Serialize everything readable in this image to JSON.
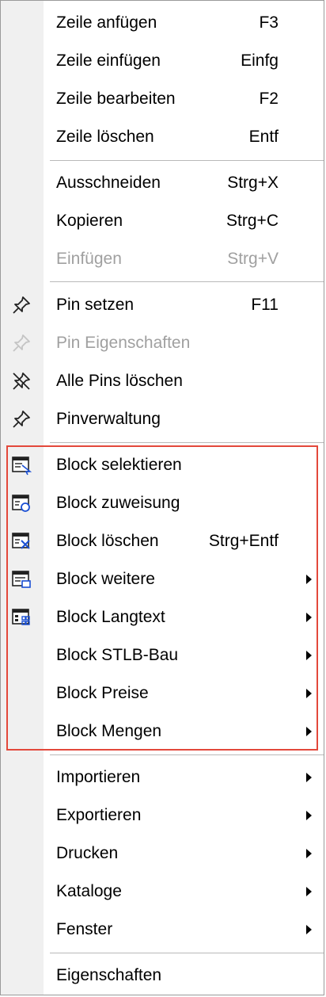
{
  "menu": {
    "items": [
      {
        "label": "Zeile anfügen",
        "shortcut": "F3"
      },
      {
        "label": "Zeile einfügen",
        "shortcut": "Einfg"
      },
      {
        "label": "Zeile bearbeiten",
        "shortcut": "F2"
      },
      {
        "label": "Zeile löschen",
        "shortcut": "Entf"
      },
      {
        "label": "Ausschneiden",
        "shortcut": "Strg+X"
      },
      {
        "label": "Kopieren",
        "shortcut": "Strg+C"
      },
      {
        "label": "Einfügen",
        "shortcut": "Strg+V",
        "disabled": true
      },
      {
        "label": "Pin setzen",
        "shortcut": "F11",
        "icon": "pin-icon"
      },
      {
        "label": "Pin Eigenschaften",
        "disabled": true,
        "icon": "pin-icon"
      },
      {
        "label": "Alle Pins löschen",
        "icon": "pin-remove-icon"
      },
      {
        "label": "Pinverwaltung",
        "icon": "pin-icon"
      },
      {
        "label": "Block selektieren",
        "icon": "block-select-icon"
      },
      {
        "label": "Block zuweisung",
        "icon": "block-assign-icon"
      },
      {
        "label": "Block löschen",
        "shortcut": "Strg+Entf",
        "icon": "block-delete-icon"
      },
      {
        "label": "Block weitere",
        "submenu": true,
        "icon": "block-more-icon"
      },
      {
        "label": "Block Langtext",
        "submenu": true,
        "icon": "block-longtext-icon"
      },
      {
        "label": "Block STLB-Bau",
        "submenu": true
      },
      {
        "label": "Block Preise",
        "submenu": true
      },
      {
        "label": "Block Mengen",
        "submenu": true
      },
      {
        "label": "Importieren",
        "submenu": true
      },
      {
        "label": "Exportieren",
        "submenu": true
      },
      {
        "label": "Drucken",
        "submenu": true
      },
      {
        "label": "Kataloge",
        "submenu": true
      },
      {
        "label": "Fenster",
        "submenu": true
      },
      {
        "label": "Eigenschaften"
      }
    ]
  },
  "colors": {
    "highlight_border": "#e3483b",
    "gutter": "#f0f0f0",
    "disabled_text": "#a0a0a0"
  }
}
